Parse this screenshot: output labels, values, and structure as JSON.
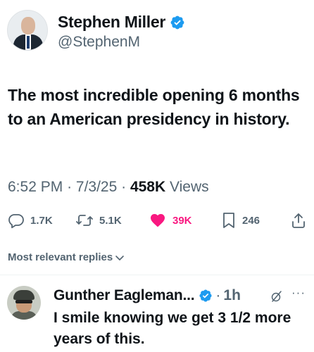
{
  "author": {
    "display_name": "Stephen Miller",
    "handle": "@StephenM",
    "verified": true
  },
  "tweet": {
    "text": "The most incredible opening 6 months to an American presidency in history.",
    "time": "6:52 PM",
    "date": "7/3/25",
    "views_count": "458K",
    "views_label": "Views"
  },
  "actions": {
    "replies": "1.7K",
    "reposts": "5.1K",
    "likes": "39K",
    "bookmarks": "246"
  },
  "colors": {
    "like": "#f91880",
    "verified": "#1d9bf0",
    "secondary_text": "#536471"
  },
  "replies_sort_label": "Most relevant replies",
  "reply": {
    "display_name": "Gunther Eagleman...",
    "time": "1h",
    "text": "I smile knowing we get 3 1/2 more years of this."
  },
  "icons": [
    "verified-badge-icon",
    "reply-icon",
    "repost-icon",
    "like-icon",
    "bookmark-icon",
    "share-icon",
    "chevron-down-icon",
    "grok-icon",
    "more-icon"
  ]
}
